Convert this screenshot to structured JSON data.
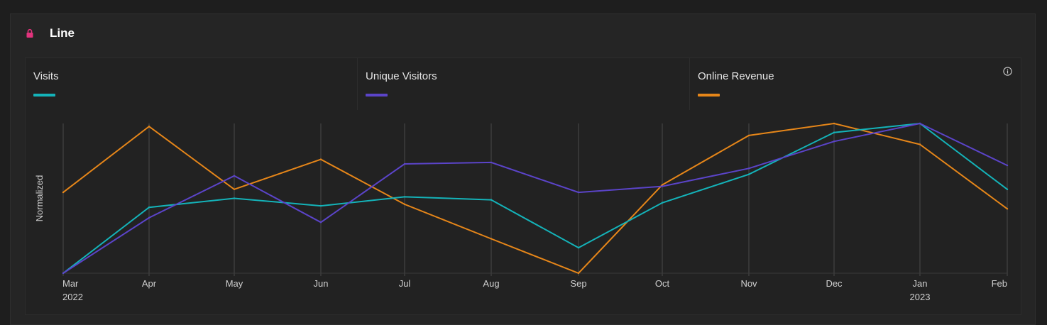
{
  "panel": {
    "title": "Line",
    "lock_icon": "lock-icon",
    "info_icon": "info-icon",
    "accent_color": "#e2337d"
  },
  "legend": [
    {
      "label": "Visits",
      "color": "#14b3b9"
    },
    {
      "label": "Unique Visitors",
      "color": "#5b44c9"
    },
    {
      "label": "Online Revenue",
      "color": "#e68619"
    }
  ],
  "chart_data": {
    "type": "line",
    "title": "",
    "xlabel": "",
    "ylabel": "Normalized",
    "ylim": [
      0,
      1
    ],
    "grid": "vertical",
    "legend_position": "top",
    "categories": [
      "Mar",
      "Apr",
      "May",
      "Jun",
      "Jul",
      "Aug",
      "Sep",
      "Oct",
      "Nov",
      "Dec",
      "Jan",
      "Feb"
    ],
    "year_labels": {
      "0": "2022",
      "10": "2023"
    },
    "series": [
      {
        "name": "Visits",
        "values": [
          0.0,
          0.44,
          0.5,
          0.45,
          0.51,
          0.49,
          0.17,
          0.47,
          0.66,
          0.94,
          1.0,
          0.56
        ]
      },
      {
        "name": "Unique Visitors",
        "values": [
          0.0,
          0.37,
          0.65,
          0.34,
          0.73,
          0.74,
          0.54,
          0.58,
          0.7,
          0.88,
          1.0,
          0.72
        ]
      },
      {
        "name": "Online Revenue",
        "values": [
          0.54,
          0.98,
          0.56,
          0.76,
          0.46,
          0.23,
          0.0,
          0.59,
          0.92,
          1.0,
          0.86,
          0.43
        ]
      }
    ]
  }
}
